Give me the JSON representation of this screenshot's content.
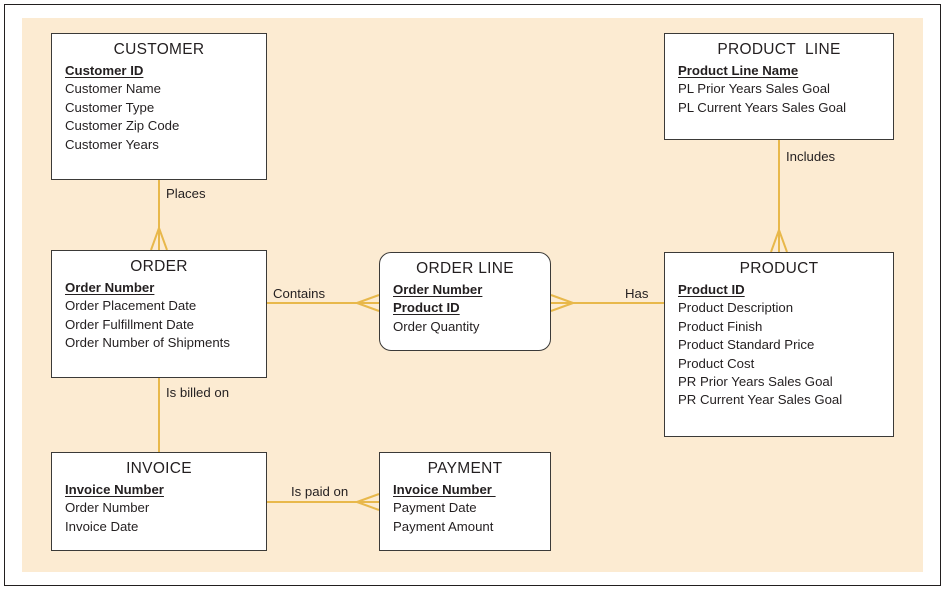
{
  "diagram": {
    "type": "entity-relationship-diagram",
    "notation": "crow's foot",
    "background_color": "#FCEBD2",
    "line_color": "#E8B84B",
    "entity_fill": "#FFFFFF",
    "entity_border": "#3B3A38"
  },
  "entities": [
    {
      "id": "customer",
      "title": "CUSTOMER",
      "shape": "rectangle",
      "attributes": [
        {
          "label": "Customer ID",
          "key": true
        },
        {
          "label": "Customer Name",
          "key": false
        },
        {
          "label": "Customer Type",
          "key": false
        },
        {
          "label": "Customer Zip Code",
          "key": false
        },
        {
          "label": "Customer Years",
          "key": false
        }
      ]
    },
    {
      "id": "product-line",
      "title": "PRODUCT  LINE",
      "shape": "rectangle",
      "attributes": [
        {
          "label": "Product Line Name",
          "key": true
        },
        {
          "label": "PL Prior Years Sales Goal",
          "key": false
        },
        {
          "label": "PL Current Years Sales Goal",
          "key": false
        }
      ]
    },
    {
      "id": "order",
      "title": "ORDER",
      "shape": "rectangle",
      "attributes": [
        {
          "label": "Order Number",
          "key": true
        },
        {
          "label": "Order Placement Date",
          "key": false
        },
        {
          "label": "Order Fulfillment Date",
          "key": false
        },
        {
          "label": "Order Number of Shipments",
          "key": false
        }
      ]
    },
    {
      "id": "order-line",
      "title": "ORDER LINE",
      "shape": "rounded-rectangle",
      "attributes": [
        {
          "label": "Order Number",
          "key": true
        },
        {
          "label": "Product ID",
          "key": true
        },
        {
          "label": "Order Quantity",
          "key": false
        }
      ]
    },
    {
      "id": "product",
      "title": "PRODUCT",
      "shape": "rectangle",
      "attributes": [
        {
          "label": "Product ID",
          "key": true
        },
        {
          "label": "Product Description",
          "key": false
        },
        {
          "label": "Product Finish",
          "key": false
        },
        {
          "label": "Product Standard Price",
          "key": false
        },
        {
          "label": "Product Cost",
          "key": false
        },
        {
          "label": "PR Prior Years Sales Goal",
          "key": false
        },
        {
          "label": "PR Current Year Sales Goal",
          "key": false
        }
      ]
    },
    {
      "id": "invoice",
      "title": "INVOICE",
      "shape": "rectangle",
      "attributes": [
        {
          "label": "Invoice Number",
          "key": true
        },
        {
          "label": "Order Number",
          "key": false
        },
        {
          "label": "Invoice Date",
          "key": false
        }
      ]
    },
    {
      "id": "payment",
      "title": "PAYMENT",
      "shape": "rectangle",
      "attributes": [
        {
          "label": "Invoice Number ",
          "key": true
        },
        {
          "label": "Payment Date",
          "key": false
        },
        {
          "label": "Payment Amount",
          "key": false
        }
      ]
    }
  ],
  "relationships": [
    {
      "id": "places",
      "label": "Places",
      "from": "customer",
      "to": "order",
      "many_end": "order"
    },
    {
      "id": "includes",
      "label": "Includes",
      "from": "product-line",
      "to": "product",
      "many_end": "product"
    },
    {
      "id": "contains",
      "label": "Contains",
      "from": "order",
      "to": "order-line",
      "many_end": "order-line"
    },
    {
      "id": "has",
      "label": "Has",
      "from": "product",
      "to": "order-line",
      "many_end": "order-line"
    },
    {
      "id": "is-billed-on",
      "label": "Is billed on",
      "from": "order",
      "to": "invoice",
      "many_end": "none"
    },
    {
      "id": "is-paid-on",
      "label": "Is paid on",
      "from": "invoice",
      "to": "payment",
      "many_end": "payment"
    }
  ]
}
